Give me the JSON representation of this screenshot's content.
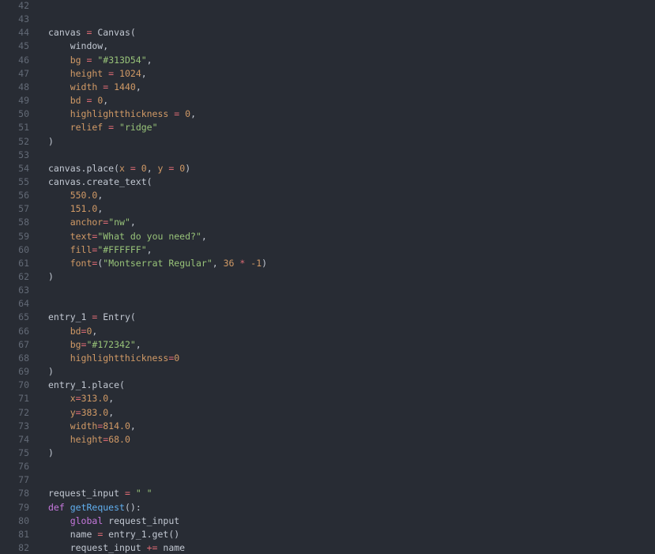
{
  "editor": {
    "colors": {
      "background": "#282c34",
      "line_number": "#636a76",
      "plain": "#c2c8d2",
      "operator": "#e06c75",
      "number": "#d19a66",
      "string": "#98c379",
      "keyword": "#c678dd",
      "function": "#61afef",
      "kwarg": "#d19a66"
    },
    "lines": [
      {
        "number": "42",
        "tokens": []
      },
      {
        "number": "43",
        "tokens": []
      },
      {
        "number": "44",
        "tokens": [
          {
            "t": "canvas ",
            "k": "plain"
          },
          {
            "t": "=",
            "k": "op"
          },
          {
            "t": " Canvas(",
            "k": "plain"
          }
        ]
      },
      {
        "number": "45",
        "tokens": [
          {
            "t": "    window,",
            "k": "plain"
          }
        ]
      },
      {
        "number": "46",
        "tokens": [
          {
            "t": "    bg ",
            "k": "kwarg"
          },
          {
            "t": "=",
            "k": "op"
          },
          {
            "t": " ",
            "k": "plain"
          },
          {
            "t": "\"#313D54\"",
            "k": "str"
          },
          {
            "t": ",",
            "k": "plain"
          }
        ]
      },
      {
        "number": "47",
        "tokens": [
          {
            "t": "    height ",
            "k": "kwarg"
          },
          {
            "t": "=",
            "k": "op"
          },
          {
            "t": " ",
            "k": "plain"
          },
          {
            "t": "1024",
            "k": "num"
          },
          {
            "t": ",",
            "k": "plain"
          }
        ]
      },
      {
        "number": "48",
        "tokens": [
          {
            "t": "    width ",
            "k": "kwarg"
          },
          {
            "t": "=",
            "k": "op"
          },
          {
            "t": " ",
            "k": "plain"
          },
          {
            "t": "1440",
            "k": "num"
          },
          {
            "t": ",",
            "k": "plain"
          }
        ]
      },
      {
        "number": "49",
        "tokens": [
          {
            "t": "    bd ",
            "k": "kwarg"
          },
          {
            "t": "=",
            "k": "op"
          },
          {
            "t": " ",
            "k": "plain"
          },
          {
            "t": "0",
            "k": "num"
          },
          {
            "t": ",",
            "k": "plain"
          }
        ]
      },
      {
        "number": "50",
        "tokens": [
          {
            "t": "    highlightthickness ",
            "k": "kwarg"
          },
          {
            "t": "=",
            "k": "op"
          },
          {
            "t": " ",
            "k": "plain"
          },
          {
            "t": "0",
            "k": "num"
          },
          {
            "t": ",",
            "k": "plain"
          }
        ]
      },
      {
        "number": "51",
        "tokens": [
          {
            "t": "    relief ",
            "k": "kwarg"
          },
          {
            "t": "=",
            "k": "op"
          },
          {
            "t": " ",
            "k": "plain"
          },
          {
            "t": "\"ridge\"",
            "k": "str"
          }
        ]
      },
      {
        "number": "52",
        "tokens": [
          {
            "t": ")",
            "k": "plain"
          }
        ]
      },
      {
        "number": "53",
        "tokens": []
      },
      {
        "number": "54",
        "tokens": [
          {
            "t": "canvas.place(",
            "k": "plain"
          },
          {
            "t": "x ",
            "k": "kwarg"
          },
          {
            "t": "=",
            "k": "op"
          },
          {
            "t": " ",
            "k": "plain"
          },
          {
            "t": "0",
            "k": "num"
          },
          {
            "t": ", ",
            "k": "plain"
          },
          {
            "t": "y ",
            "k": "kwarg"
          },
          {
            "t": "=",
            "k": "op"
          },
          {
            "t": " ",
            "k": "plain"
          },
          {
            "t": "0",
            "k": "num"
          },
          {
            "t": ")",
            "k": "plain"
          }
        ]
      },
      {
        "number": "55",
        "tokens": [
          {
            "t": "canvas.create_text(",
            "k": "plain"
          }
        ]
      },
      {
        "number": "56",
        "tokens": [
          {
            "t": "    ",
            "k": "plain"
          },
          {
            "t": "550.0",
            "k": "num"
          },
          {
            "t": ",",
            "k": "plain"
          }
        ]
      },
      {
        "number": "57",
        "tokens": [
          {
            "t": "    ",
            "k": "plain"
          },
          {
            "t": "151.0",
            "k": "num"
          },
          {
            "t": ",",
            "k": "plain"
          }
        ]
      },
      {
        "number": "58",
        "tokens": [
          {
            "t": "    anchor",
            "k": "kwarg"
          },
          {
            "t": "=",
            "k": "op"
          },
          {
            "t": "\"nw\"",
            "k": "str"
          },
          {
            "t": ",",
            "k": "plain"
          }
        ]
      },
      {
        "number": "59",
        "tokens": [
          {
            "t": "    text",
            "k": "kwarg"
          },
          {
            "t": "=",
            "k": "op"
          },
          {
            "t": "\"What do you need?\"",
            "k": "str"
          },
          {
            "t": ",",
            "k": "plain"
          }
        ]
      },
      {
        "number": "60",
        "tokens": [
          {
            "t": "    fill",
            "k": "kwarg"
          },
          {
            "t": "=",
            "k": "op"
          },
          {
            "t": "\"#FFFFFF\"",
            "k": "str"
          },
          {
            "t": ",",
            "k": "plain"
          }
        ]
      },
      {
        "number": "61",
        "tokens": [
          {
            "t": "    font",
            "k": "kwarg"
          },
          {
            "t": "=",
            "k": "op"
          },
          {
            "t": "(",
            "k": "plain"
          },
          {
            "t": "\"Montserrat Regular\"",
            "k": "str"
          },
          {
            "t": ", ",
            "k": "plain"
          },
          {
            "t": "36",
            "k": "num"
          },
          {
            "t": " ",
            "k": "plain"
          },
          {
            "t": "*",
            "k": "op"
          },
          {
            "t": " ",
            "k": "plain"
          },
          {
            "t": "-1",
            "k": "num"
          },
          {
            "t": ")",
            "k": "plain"
          }
        ]
      },
      {
        "number": "62",
        "tokens": [
          {
            "t": ")",
            "k": "plain"
          }
        ]
      },
      {
        "number": "63",
        "tokens": []
      },
      {
        "number": "64",
        "tokens": []
      },
      {
        "number": "65",
        "tokens": [
          {
            "t": "entry_1 ",
            "k": "plain"
          },
          {
            "t": "=",
            "k": "op"
          },
          {
            "t": " Entry(",
            "k": "plain"
          }
        ]
      },
      {
        "number": "66",
        "tokens": [
          {
            "t": "    bd",
            "k": "kwarg"
          },
          {
            "t": "=",
            "k": "op"
          },
          {
            "t": "0",
            "k": "num"
          },
          {
            "t": ",",
            "k": "plain"
          }
        ]
      },
      {
        "number": "67",
        "tokens": [
          {
            "t": "    bg",
            "k": "kwarg"
          },
          {
            "t": "=",
            "k": "op"
          },
          {
            "t": "\"#172342\"",
            "k": "str"
          },
          {
            "t": ",",
            "k": "plain"
          }
        ]
      },
      {
        "number": "68",
        "tokens": [
          {
            "t": "    highlightthickness",
            "k": "kwarg"
          },
          {
            "t": "=",
            "k": "op"
          },
          {
            "t": "0",
            "k": "num"
          }
        ]
      },
      {
        "number": "69",
        "tokens": [
          {
            "t": ")",
            "k": "plain"
          }
        ]
      },
      {
        "number": "70",
        "tokens": [
          {
            "t": "entry_1.place(",
            "k": "plain"
          }
        ]
      },
      {
        "number": "71",
        "tokens": [
          {
            "t": "    x",
            "k": "kwarg"
          },
          {
            "t": "=",
            "k": "op"
          },
          {
            "t": "313.0",
            "k": "num"
          },
          {
            "t": ",",
            "k": "plain"
          }
        ]
      },
      {
        "number": "72",
        "tokens": [
          {
            "t": "    y",
            "k": "kwarg"
          },
          {
            "t": "=",
            "k": "op"
          },
          {
            "t": "383.0",
            "k": "num"
          },
          {
            "t": ",",
            "k": "plain"
          }
        ]
      },
      {
        "number": "73",
        "tokens": [
          {
            "t": "    width",
            "k": "kwarg"
          },
          {
            "t": "=",
            "k": "op"
          },
          {
            "t": "814.0",
            "k": "num"
          },
          {
            "t": ",",
            "k": "plain"
          }
        ]
      },
      {
        "number": "74",
        "tokens": [
          {
            "t": "    height",
            "k": "kwarg"
          },
          {
            "t": "=",
            "k": "op"
          },
          {
            "t": "68.0",
            "k": "num"
          }
        ]
      },
      {
        "number": "75",
        "tokens": [
          {
            "t": ")",
            "k": "plain"
          }
        ]
      },
      {
        "number": "76",
        "tokens": []
      },
      {
        "number": "77",
        "tokens": []
      },
      {
        "number": "78",
        "tokens": [
          {
            "t": "request_input ",
            "k": "plain"
          },
          {
            "t": "=",
            "k": "op"
          },
          {
            "t": " ",
            "k": "plain"
          },
          {
            "t": "\" \"",
            "k": "str"
          }
        ]
      },
      {
        "number": "79",
        "tokens": [
          {
            "t": "def",
            "k": "kw"
          },
          {
            "t": " ",
            "k": "plain"
          },
          {
            "t": "getRequest",
            "k": "fn"
          },
          {
            "t": "():",
            "k": "plain"
          }
        ]
      },
      {
        "number": "80",
        "tokens": [
          {
            "t": "    ",
            "k": "plain"
          },
          {
            "t": "global",
            "k": "kw"
          },
          {
            "t": " request_input",
            "k": "plain"
          }
        ]
      },
      {
        "number": "81",
        "tokens": [
          {
            "t": "    name ",
            "k": "plain"
          },
          {
            "t": "=",
            "k": "op"
          },
          {
            "t": " entry_1.get()",
            "k": "plain"
          }
        ]
      },
      {
        "number": "82",
        "tokens": [
          {
            "t": "    request_input ",
            "k": "plain"
          },
          {
            "t": "+=",
            "k": "op"
          },
          {
            "t": " name",
            "k": "plain"
          }
        ]
      }
    ]
  }
}
